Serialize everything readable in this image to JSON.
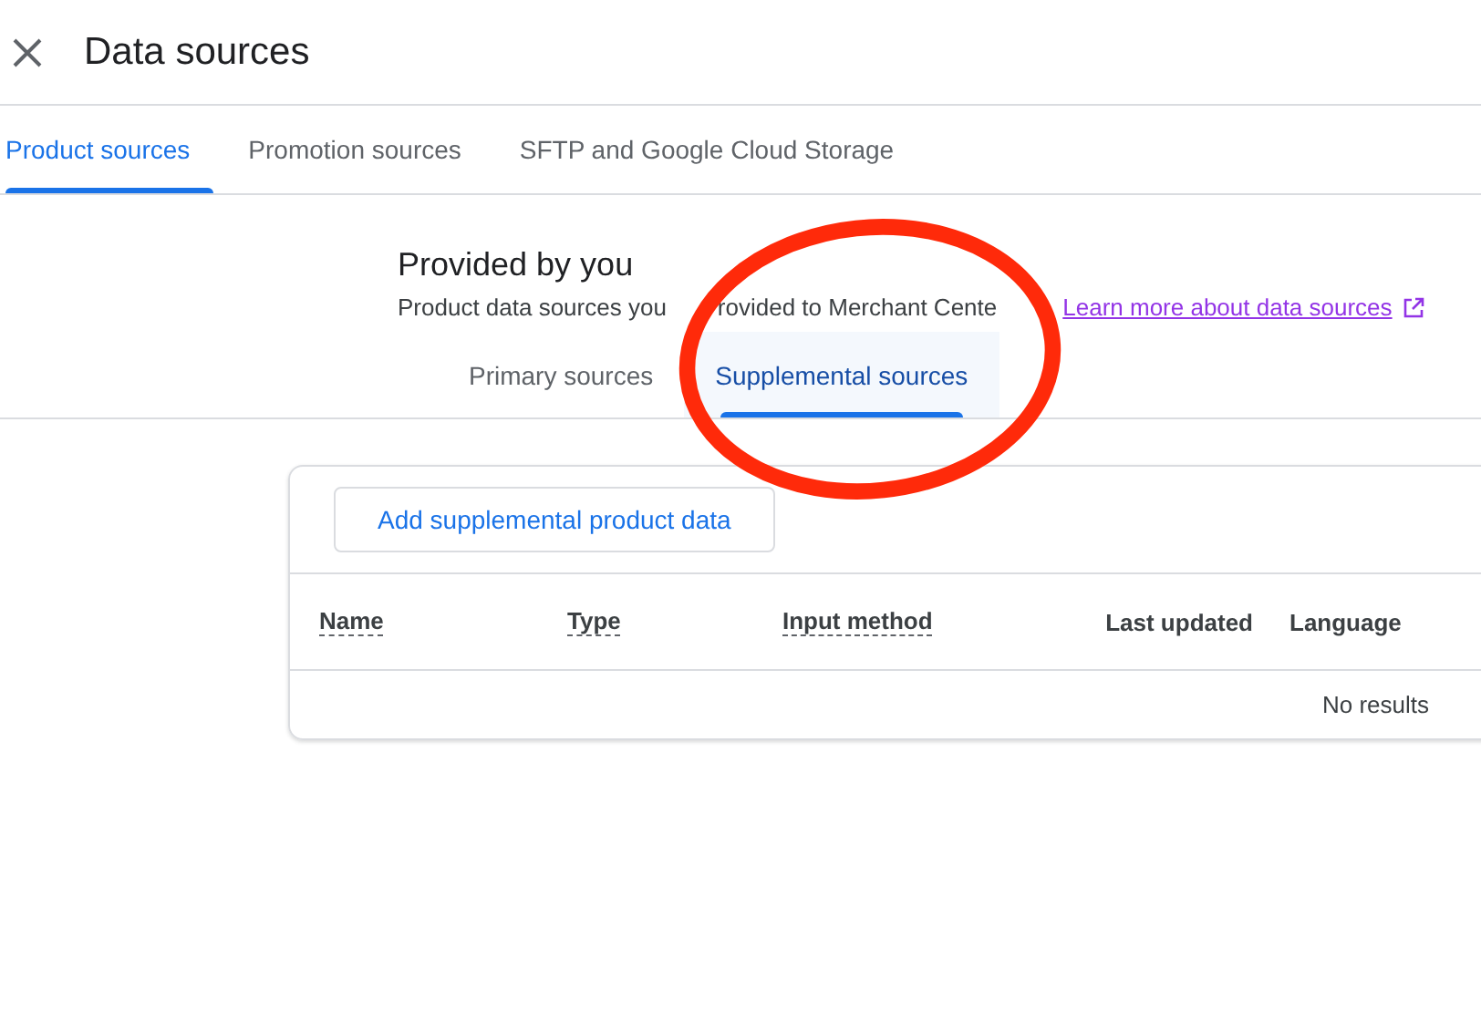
{
  "header": {
    "title": "Data sources"
  },
  "tabs": [
    {
      "label": "Product sources",
      "selected": true
    },
    {
      "label": "Promotion sources",
      "selected": false
    },
    {
      "label": "SFTP and Google Cloud Storage",
      "selected": false
    }
  ],
  "section": {
    "title": "Provided by you",
    "description_parts": [
      "Product data sources you",
      "rovided to Merchant Cente"
    ],
    "link": "Learn more about data sources"
  },
  "subtabs": [
    {
      "label": "Primary sources",
      "selected": false
    },
    {
      "label": "Supplemental sources",
      "selected": true
    }
  ],
  "add_button": "Add supplemental product data",
  "table": {
    "columns": [
      {
        "label": "Name",
        "dashed": true
      },
      {
        "label": "Type",
        "dashed": true
      },
      {
        "label": "Input method",
        "dashed": true
      },
      {
        "label": "Last updated",
        "dashed": false
      },
      {
        "label": "Language",
        "dashed": false
      }
    ],
    "empty_message": "No results"
  }
}
